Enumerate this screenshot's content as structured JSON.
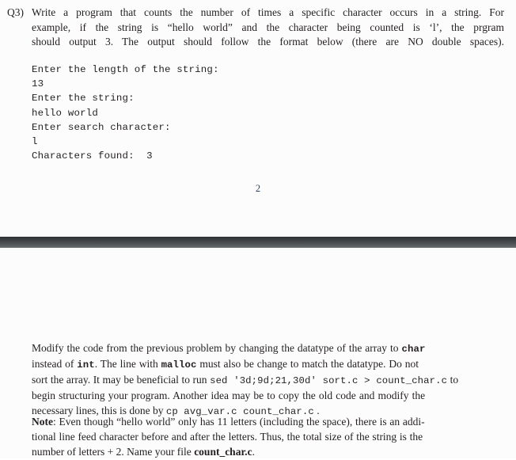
{
  "document": {
    "background_color": "#fcfcfd",
    "text_color": "#231f20",
    "page_break_color": "#4a4e51"
  },
  "page_top": {
    "question": {
      "label": "Q3)",
      "lines": [
        "Write a program that counts the number of times a specific character occurs in a string. For",
        "example, if the string is “hello world” and the character being counted is ‘l’, the prgram",
        "should output 3. The output should follow the format below (there are NO double spaces)."
      ]
    },
    "console_sample": {
      "lines": [
        "Enter the length of the string:",
        "13",
        "Enter the string:",
        "hello world",
        "Enter search character:",
        "l",
        "Characters found:  3"
      ]
    },
    "page_number": "2"
  },
  "page_bottom": {
    "paragraph": {
      "line1_pre": "Modify the code from the previous problem by changing the datatype of the array to ",
      "line1_code": "char",
      "line2_pre": "instead of ",
      "line2_code1": "int",
      "line2_mid": ". The line with ",
      "line2_code2": "malloc",
      "line2_post": " must also be change to match the datatype.  Do not",
      "line3_pre": "sort the array. It may be beneficial to run ",
      "line3_code": "sed '3d;9d;21,30d' sort.c > count_char.c",
      "line3_post": " to",
      "line4": "begin structuring your program.  Another idea may be to copy the old code and modify the",
      "line5_pre": "necessary lines, this is done by ",
      "line5_code": "cp avg_var.c count_char.c",
      "line5_post": " ."
    },
    "note": {
      "label": "Note",
      "line1_rest": ": Even though “hello world” only has 11 letters (including the space), there is an addi-",
      "line2": "tional line feed character before and after the letters. Thus, the total size of the string is the",
      "line3_pre": "number of letters + 2. Name your file ",
      "line3_bold": "count_char.c",
      "line3_post": "."
    }
  }
}
